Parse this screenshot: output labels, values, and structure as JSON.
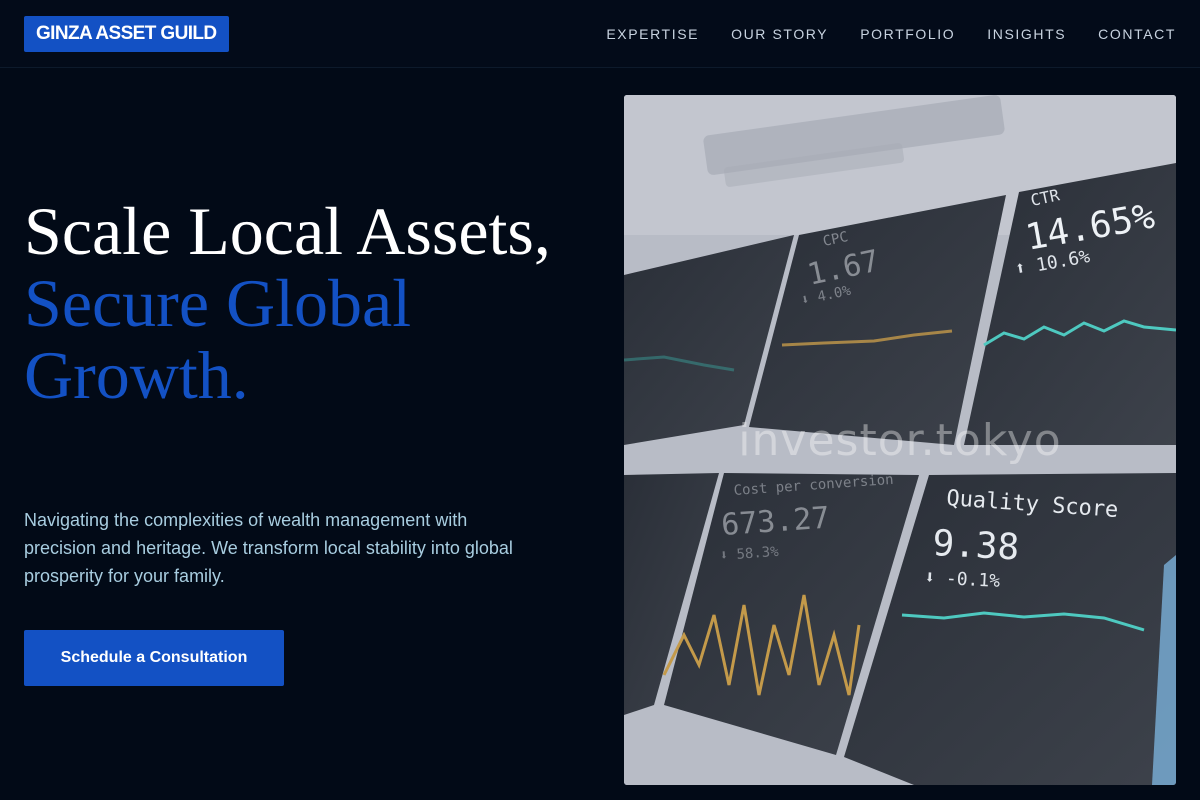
{
  "brand": {
    "logo_text": "GINZA ASSET GUILD"
  },
  "nav": {
    "items": [
      {
        "label": "EXPERTISE"
      },
      {
        "label": "OUR STORY"
      },
      {
        "label": "PORTFOLIO"
      },
      {
        "label": "INSIGHTS"
      },
      {
        "label": "CONTACT"
      }
    ]
  },
  "hero": {
    "title_line1": "Scale Local Assets,",
    "title_line2": "Secure Global Growth.",
    "description": "Navigating the complexities of wealth management with precision and heritage. We transform local stability into global prosperity for your family.",
    "cta_label": "Schedule a Consultation"
  },
  "image": {
    "watermark": "investor.tokyo",
    "dashboard": {
      "panels": [
        {
          "title": "CTR",
          "value": "14.65%",
          "change": "⬆ 10.6%"
        },
        {
          "title": "CPC",
          "value": "1.67",
          "change": "⬇ 4.0%"
        },
        {
          "title": "Cost per conversion",
          "value": "673.27",
          "change": "⬇ 58.3%"
        },
        {
          "title": "Quality Score",
          "value": "9.38",
          "change": "⬇ -0.1%"
        }
      ]
    }
  },
  "colors": {
    "background": "#020a17",
    "accent": "#1351c4",
    "body_text": "#a8cde0",
    "nav_text": "#c8d3e0"
  }
}
